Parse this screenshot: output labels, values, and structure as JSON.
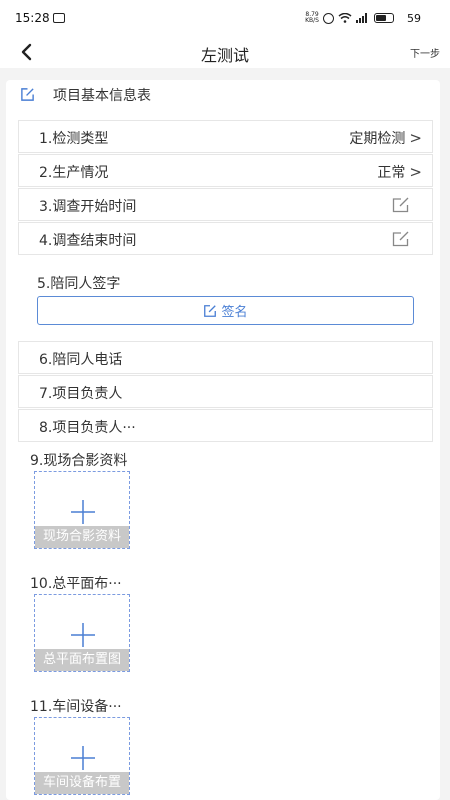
{
  "status_bar": {
    "time": "15:28",
    "net_speed_top": "8.79",
    "net_speed_bottom": "KB/S",
    "battery": "59"
  },
  "nav": {
    "title": "左测试",
    "next_label": "下一步"
  },
  "section": {
    "title": "项目基本信息表"
  },
  "rows": {
    "r1": {
      "label": "1.检测类型",
      "value": "定期检测"
    },
    "r2": {
      "label": "2.生产情况",
      "value": "正常"
    },
    "r3": {
      "label": "3.调查开始时间"
    },
    "r4": {
      "label": "4.调查结束时间"
    },
    "r6": {
      "label": "6.陪同人电话"
    },
    "r7": {
      "label": "7.项目负责人"
    },
    "r8": {
      "label": "8.项目负责人···"
    }
  },
  "sign": {
    "label": "5.陪同人签字",
    "button_label": "签名"
  },
  "photos": {
    "p9": {
      "title": "9.现场合影资料",
      "caption": "现场合影资料"
    },
    "p10": {
      "title": "10.总平面布···",
      "caption": "总平面布置图"
    },
    "p11": {
      "title": "11.车间设备···",
      "caption": "车间设备布置"
    }
  },
  "icons": {
    "back": "chevron-left-icon",
    "section": "edit-square-icon",
    "edit": "edit-icon",
    "add": "plus-icon"
  },
  "colors": {
    "accent": "#4a7fd4",
    "caption_bg": "#c8c8c8",
    "page_bg": "#f3f3f3"
  }
}
